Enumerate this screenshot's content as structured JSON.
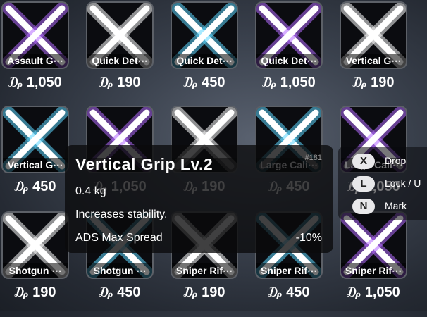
{
  "currency_symbol": "₯",
  "items": [
    {
      "name": "Assault G⋯",
      "price": "1,050",
      "glow": "#b56cff"
    },
    {
      "name": "Quick Det⋯",
      "price": "190",
      "glow": "#ffffff"
    },
    {
      "name": "Quick Det⋯",
      "price": "450",
      "glow": "#5fd8ff"
    },
    {
      "name": "Quick Det⋯",
      "price": "1,050",
      "glow": "#b56cff"
    },
    {
      "name": "Vertical G⋯",
      "price": "190",
      "glow": "#ffffff"
    },
    {
      "name": "Vertical G⋯",
      "price": "450",
      "glow": "#5fd8ff"
    },
    {
      "name": "",
      "price": "1,050",
      "glow": "#b56cff"
    },
    {
      "name": "",
      "price": "190",
      "glow": "#ffffff"
    },
    {
      "name": "Large Cali⋯",
      "price": "450",
      "glow": "#5fd8ff"
    },
    {
      "name": "Large Cali⋯",
      "price": "1,050",
      "glow": "#b56cff"
    },
    {
      "name": "Shotgun ⋯",
      "price": "190",
      "glow": "#ffffff"
    },
    {
      "name": "Shotgun ⋯",
      "price": "450",
      "glow": "#5fd8ff"
    },
    {
      "name": "Sniper Rif⋯",
      "price": "190",
      "glow": "#ffffff"
    },
    {
      "name": "Sniper Rif⋯",
      "price": "450",
      "glow": "#5fd8ff"
    },
    {
      "name": "Sniper Rif⋯",
      "price": "1,050",
      "glow": "#b56cff"
    }
  ],
  "tooltip": {
    "title": "Vertical Grip Lv.2",
    "id": "#181",
    "weight": "0.4 kg",
    "description": "Increases stability.",
    "stat_name": "ADS Max Spread",
    "stat_value": "-10%"
  },
  "hints": [
    {
      "key": "X",
      "label": "Drop"
    },
    {
      "key": "L",
      "label": "Lock / U"
    },
    {
      "key": "N",
      "label": "Mark"
    }
  ]
}
